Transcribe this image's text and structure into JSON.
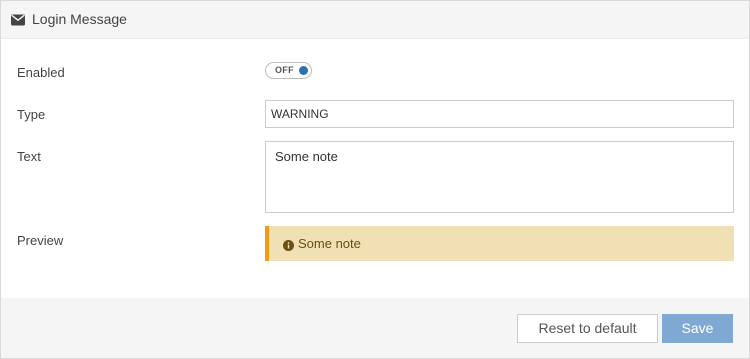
{
  "panel": {
    "title": "Login Message",
    "title_icon": "envelope-icon"
  },
  "form": {
    "enabled": {
      "label": "Enabled",
      "toggle_text": "OFF",
      "state": "off"
    },
    "type": {
      "label": "Type",
      "value": "WARNING"
    },
    "text": {
      "label": "Text",
      "value": "Some note"
    },
    "preview": {
      "label": "Preview",
      "icon": "info-circle-icon",
      "message": "Some note",
      "background_color": "#f0e0b3",
      "accent_color": "#f39c12"
    }
  },
  "footer": {
    "reset_label": "Reset to default",
    "save_label": "Save",
    "save_color": "#7fa9d3"
  }
}
